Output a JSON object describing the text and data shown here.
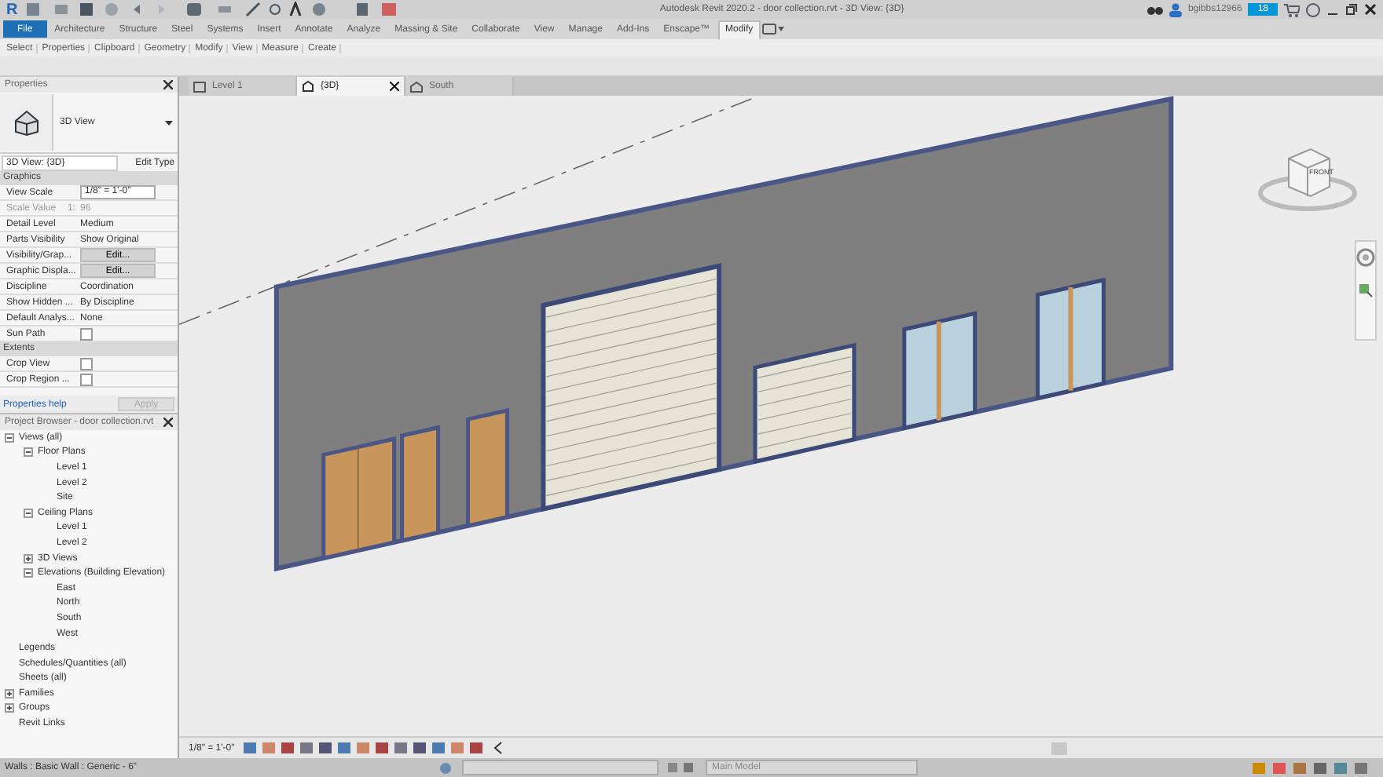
{
  "title_bar": {
    "logo": "R",
    "title": "Autodesk Revit 2020.2 - door collection.rvt - 3D View: {3D}",
    "user": "bgibbs12966",
    "badge": "18"
  },
  "ribbon": {
    "file_tab": "File",
    "tabs": [
      {
        "label": "Architecture",
        "selected": false
      },
      {
        "label": "Structure",
        "selected": false
      },
      {
        "label": "Steel",
        "selected": false
      },
      {
        "label": "Systems",
        "selected": false
      },
      {
        "label": "Insert",
        "selected": false
      },
      {
        "label": "Annotate",
        "selected": false
      },
      {
        "label": "Analyze",
        "selected": false
      },
      {
        "label": "Massing & Site",
        "selected": false
      },
      {
        "label": "Collaborate",
        "selected": false
      },
      {
        "label": "View",
        "selected": false
      },
      {
        "label": "Manage",
        "selected": false
      },
      {
        "label": "Add-Ins",
        "selected": false
      },
      {
        "label": "Enscape™",
        "selected": false
      },
      {
        "label": "Modify",
        "selected": true
      }
    ],
    "panels": [
      "Select",
      "Properties",
      "Clipboard",
      "Geometry",
      "Modify",
      "View",
      "Measure",
      "Create"
    ]
  },
  "properties": {
    "title": "Properties",
    "type_name": "3D View",
    "instance": "3D View: {3D}",
    "edit_type": "Edit Type",
    "sections": [
      {
        "title": "Graphics",
        "rows": [
          {
            "kind": "field",
            "label": "View Scale",
            "value": "1/8\" = 1'-0\""
          },
          {
            "kind": "readonly",
            "label": "Scale Value",
            "unit": "1:",
            "value": "96"
          },
          {
            "kind": "text",
            "label": "Detail Level",
            "value": "Medium"
          },
          {
            "kind": "text",
            "label": "Parts Visibility",
            "value": "Show Original"
          },
          {
            "kind": "button",
            "label": "Visibility/Grap...",
            "value": "Edit..."
          },
          {
            "kind": "button",
            "label": "Graphic Displa...",
            "value": "Edit..."
          },
          {
            "kind": "text",
            "label": "Discipline",
            "value": "Coordination"
          },
          {
            "kind": "text",
            "label": "Show Hidden ...",
            "value": "By Discipline"
          },
          {
            "kind": "text",
            "label": "Default Analys...",
            "value": "None"
          },
          {
            "kind": "checkbox",
            "label": "Sun Path",
            "checked": false
          }
        ]
      },
      {
        "title": "Extents",
        "rows": [
          {
            "kind": "checkbox",
            "label": "Crop View",
            "checked": false
          },
          {
            "kind": "checkbox",
            "label": "Crop Region ...",
            "checked": false
          }
        ]
      }
    ],
    "help": "Properties help",
    "apply": "Apply",
    "apply_disabled": true
  },
  "browser": {
    "title": "Project Browser - door collection.rvt",
    "tree": [
      {
        "label": "Views (all)",
        "expanded": true,
        "children": [
          {
            "label": "Floor Plans",
            "expanded": true,
            "children": [
              {
                "label": "Level 1"
              },
              {
                "label": "Level 2"
              },
              {
                "label": "Site"
              }
            ]
          },
          {
            "label": "Ceiling Plans",
            "expanded": true,
            "children": [
              {
                "label": "Level 1"
              },
              {
                "label": "Level 2"
              }
            ]
          },
          {
            "label": "3D Views",
            "expanded": false
          },
          {
            "label": "Elevations (Building Elevation)",
            "expanded": true,
            "children": [
              {
                "label": "East"
              },
              {
                "label": "North"
              },
              {
                "label": "South"
              },
              {
                "label": "West"
              }
            ]
          }
        ]
      },
      {
        "label": "Legends"
      },
      {
        "label": "Schedules/Quantities (all)"
      },
      {
        "label": "Sheets (all)"
      },
      {
        "label": "Families",
        "expanded": false
      },
      {
        "label": "Groups",
        "expanded": false
      },
      {
        "label": "Revit Links"
      }
    ]
  },
  "view_tabs": [
    {
      "label": "Level 1",
      "kind": "plan",
      "selected": false
    },
    {
      "label": "{3D}",
      "kind": "perspective",
      "selected": true
    },
    {
      "label": "South",
      "kind": "elevation",
      "selected": false
    }
  ],
  "viewcube": {
    "face": "FRONT"
  },
  "view_bar": {
    "scale": "1/8\" = 1'-0\""
  },
  "status_bar": {
    "selection": "Walls : Basic Wall : Generic - 6\"",
    "model": "Main Model"
  }
}
